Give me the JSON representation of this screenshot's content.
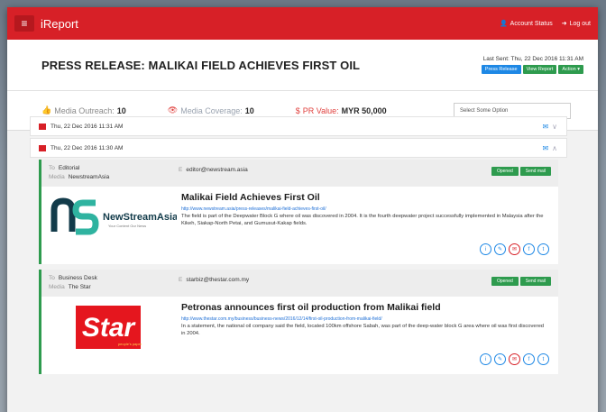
{
  "app": {
    "name": "iReport"
  },
  "topbar": {
    "account_label": "Account Status",
    "logout_label": "Log out"
  },
  "header": {
    "title": "PRESS RELEASE: MALIKAI FIELD ACHIEVES FIRST OIL",
    "last_sent": "Last Sent: Thu, 22 Dec 2016 11:31 AM",
    "press_release_btn": "Press Release",
    "view_report_btn": "View Report",
    "action_btn": "Action ▾"
  },
  "stats": {
    "outreach_label": "Media Outreach:",
    "outreach_value": "10",
    "coverage_label": "Media Coverage:",
    "coverage_value": "10",
    "pr_label": "PR Value:",
    "pr_value": "MYR 50,000",
    "select_placeholder": "Select Some Option"
  },
  "rows": [
    {
      "date": "Thu, 22 Dec 2016 11:31 AM"
    },
    {
      "date": "Thu, 22 Dec 2016 11:30 AM"
    }
  ],
  "cards": [
    {
      "to_label": "To",
      "to": "Editorial",
      "media_label": "Media",
      "media": "NewstreamAsia",
      "email_label": "E",
      "email": "editor@newstream.asia",
      "opened_btn": "Opened",
      "send_btn": "Send mail",
      "logo_text": "NewStreamAsia",
      "logo_tag": "Your Content Our News",
      "headline": "Malikai Field Achieves First Oil",
      "link": "http://www.newstream.asia/press-releases/malikai-field-achieves-first-oil/",
      "snippet": "The field is part of the Deepwater Block G where oil was discovered in 2004. It is the fourth deepwater project successfully implemented in Malaysia after the Kikeh, Siakap-North Petai, and Gumusut-Kakap fields."
    },
    {
      "to_label": "To",
      "to": "Business Desk",
      "media_label": "Media",
      "media": "The Star",
      "email_label": "E",
      "email": "starbiz@thestar.com.my",
      "opened_btn": "Opened",
      "send_btn": "Send mail",
      "logo_text": "Star",
      "logo_tag": "people's paper",
      "headline": "Petronas announces first oil production from Malikai field",
      "link": "http://www.thestar.com.my/business/business-news/2016/12/14/first-oil-production-from-malikai-field/",
      "snippet": "In a statement, the national oil company said the field, located 100km offshore Sabah, was part of the deep-water block G area where oil was first discovered in 2004."
    }
  ],
  "colors": {
    "brand": "#d72027",
    "accent": "#1e88e5",
    "success": "#2e9b4e"
  }
}
